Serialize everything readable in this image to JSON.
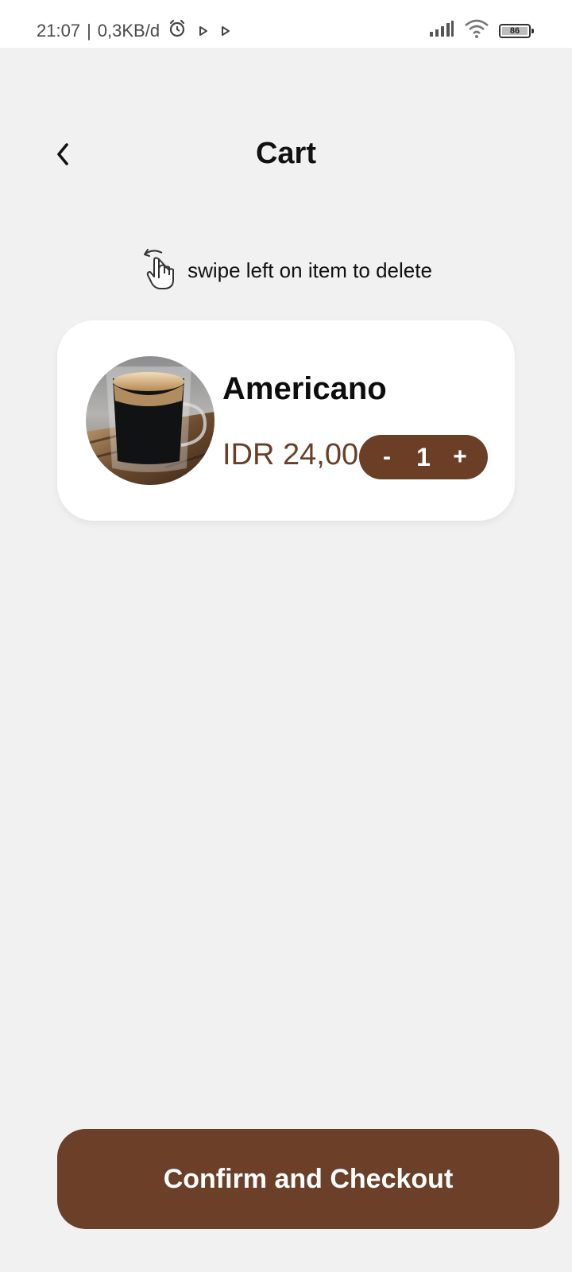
{
  "status_bar": {
    "time": "21:07",
    "separator": "|",
    "network_speed": "0,3KB/d",
    "icons_left": [
      "alarm-icon",
      "play-icon",
      "play-icon"
    ],
    "icons_right": [
      "signal-icon",
      "wifi-icon",
      "battery-icon"
    ],
    "battery_level": "86"
  },
  "header": {
    "back_icon": "chevron-left-icon",
    "title": "Cart"
  },
  "hint": {
    "icon": "swipe-hand-icon",
    "text": "swipe left on item to delete"
  },
  "cart": {
    "items": [
      {
        "name": "Americano",
        "price": "IDR 24,00",
        "quantity": "1",
        "minus_label": "-",
        "plus_label": "+"
      }
    ]
  },
  "checkout": {
    "label": "Confirm and Checkout"
  },
  "colors": {
    "background": "#f1f1f2",
    "card": "#ffffff",
    "accent_brown": "#6b3f26",
    "text_dark": "#111111"
  }
}
